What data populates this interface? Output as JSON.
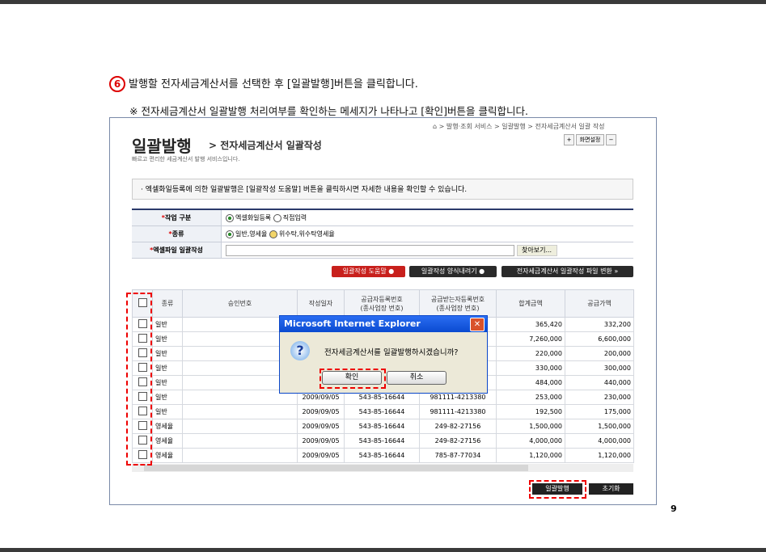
{
  "instruction": {
    "step": "6",
    "text": "발행할 전자세금계산서를 선택한 후 [일괄발행]버튼을 클릭합니다."
  },
  "note": "※ 전자세금계산서 일괄발행 처리여부를 확인하는 메세지가 나타나고 [확인]버튼을 클릭합니다.",
  "breadcrumb": "⌂ > 발행·조회 서비스 > 일괄발행 > 전자세금계산서 일괄 작성",
  "title": "일괄발행",
  "subtitle": "> 전자세금계산서 일괄작성",
  "description": "빠르고 편리한 세금계산서 발행 서비스입니다.",
  "screen_buttons": {
    "plus": "+",
    "settings": "화면설정",
    "minus": "−"
  },
  "info": "· 엑셀화일등록에 의한 일괄발행은 [일괄작성 도움말] 버튼을 클릭하시면 자세한 내용을 확인할 수 있습니다.",
  "form": {
    "work_label": "작업 구분",
    "work_opt1": "엑셀화일등록",
    "work_opt2": "직접입력",
    "kind_label": "종류",
    "kind_opt1": "일반,영세율",
    "kind_opt2": "위수탁,위수탁영세율",
    "file_label": "엑셀파일 일괄작성",
    "browse": "찾아보기..."
  },
  "actions": {
    "help": "일괄작성 도움말 ●",
    "download": "일괄작성 양식내려기 ●",
    "convert": "전자세금계산서 일괄작성 파일 변환 »"
  },
  "table": {
    "headers": [
      "종류",
      "승인번호",
      "작성일자",
      "공급자등록번호\n(종사업장 번호)",
      "공급받는자등록번호\n(종사업장 번호)",
      "합계금액",
      "공급가액"
    ],
    "rows": [
      [
        "일반",
        "",
        "",
        "",
        "",
        "365,420",
        "332,200"
      ],
      [
        "일반",
        "",
        "",
        "",
        "",
        "7,260,000",
        "6,600,000"
      ],
      [
        "일반",
        "",
        "",
        "",
        "",
        "220,000",
        "200,000"
      ],
      [
        "일반",
        "",
        "",
        "",
        "",
        "330,000",
        "300,000"
      ],
      [
        "일반",
        "",
        "",
        "",
        "",
        "484,000",
        "440,000"
      ],
      [
        "일반",
        "",
        "2009/09/05",
        "543-85-16644",
        "981111-4213380",
        "253,000",
        "230,000"
      ],
      [
        "일반",
        "",
        "2009/09/05",
        "543-85-16644",
        "981111-4213380",
        "192,500",
        "175,000"
      ],
      [
        "영세율",
        "",
        "2009/09/05",
        "543-85-16644",
        "249-82-27156",
        "1,500,000",
        "1,500,000"
      ],
      [
        "영세율",
        "",
        "2009/09/05",
        "543-85-16644",
        "249-82-27156",
        "4,000,000",
        "4,000,000"
      ],
      [
        "영세율",
        "",
        "2009/09/05",
        "543-85-16644",
        "785-87-77034",
        "1,120,000",
        "1,120,000"
      ]
    ]
  },
  "dialog": {
    "title": "Microsoft Internet Explorer",
    "message": "전자세금계산서를 일괄발행하시겠습니까?",
    "ok": "확인",
    "cancel": "취소"
  },
  "bottom": {
    "issue": "일괄발행",
    "reset": "초기화"
  },
  "page_number": "9"
}
